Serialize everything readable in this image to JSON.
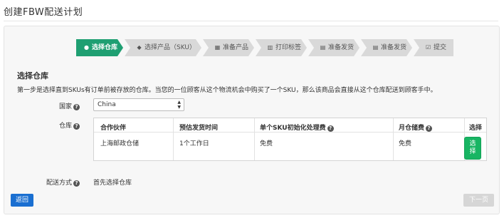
{
  "page": {
    "title": "创建FBW配送计划"
  },
  "steps": [
    {
      "label": "选择仓库",
      "icon": "globe-icon",
      "glyph": "●"
    },
    {
      "label": "选择产品（SKU）",
      "icon": "tag-icon",
      "glyph": "◆"
    },
    {
      "label": "准备产品",
      "icon": "grid-icon",
      "glyph": "▦"
    },
    {
      "label": "打印标签",
      "icon": "barcode-icon",
      "glyph": "▥"
    },
    {
      "label": "准备发货",
      "icon": "list-icon",
      "glyph": "▤"
    },
    {
      "label": "准备发货",
      "icon": "list-icon",
      "glyph": "▤"
    },
    {
      "label": "提交",
      "icon": "check-square-icon",
      "glyph": "☑"
    }
  ],
  "section": {
    "title": "选择仓库",
    "intro": "第一步是选择直到SKUs有订单前被存放的仓库。当您的一位顾客从这个物流机会中购买了一个SKU，那么该商品会直接从这个仓库配送到顾客手中。"
  },
  "form": {
    "country_label": "国家",
    "country_value": "China",
    "warehouse_label": "仓库",
    "delivery_label": "配送方式",
    "delivery_value": "首先选择仓库",
    "help_glyph": "?"
  },
  "table": {
    "headers": [
      "合作伙伴",
      "预估发货时间",
      "单个SKU初始化处理费",
      "月仓储费",
      "选择"
    ],
    "rows": [
      {
        "partner": "上海邮政仓储",
        "eta": "1个工作日",
        "init_fee": "免费",
        "monthly_fee": "免费",
        "select_label": "选择"
      }
    ]
  },
  "buttons": {
    "back": "返回",
    "next": "下一页"
  },
  "colors": {
    "active_step": "#1f9f72",
    "select_button": "#18b563",
    "back_button": "#1a6fd1",
    "next_disabled": "#d6d6d6"
  }
}
